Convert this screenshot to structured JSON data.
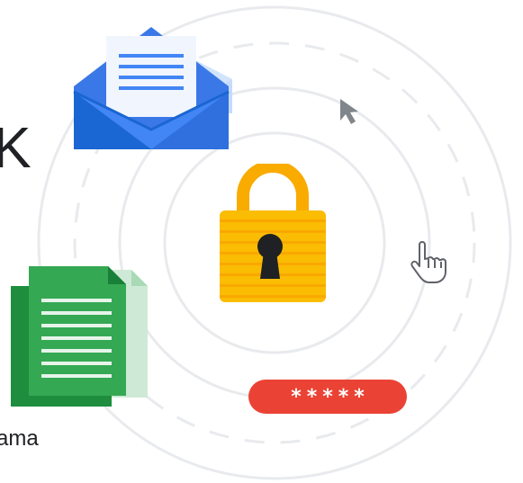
{
  "illustration": {
    "left_edge_heading": "K",
    "left_edge_caption": "ama",
    "password_field": {
      "masked_value": "*****",
      "color": "#ea4335"
    },
    "icons": [
      "envelope-icon",
      "padlock-icon",
      "cursor-arrow-icon",
      "hand-pointer-icon",
      "document-icon",
      "password-pill-icon"
    ],
    "colors": {
      "envelope_blue": "#4285f4",
      "envelope_dark_blue": "#1a66d2",
      "lock_yellow": "#fbbc04",
      "document_green": "#34a853",
      "document_dark_green": "#1e8e3e",
      "ring_gray": "#e8eaed"
    }
  }
}
